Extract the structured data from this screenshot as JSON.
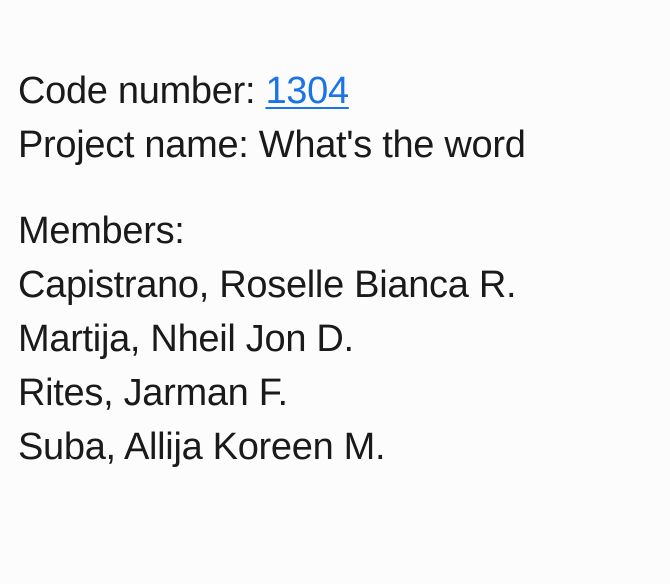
{
  "note": {
    "code_label": "Code number: ",
    "code_value": "1304",
    "project_label": "Project name: ",
    "project_value": "What's the word",
    "members_heading": "Members:",
    "members": [
      "Capistrano, Roselle Bianca R.",
      "Martija, Nheil Jon D.",
      "Rites, Jarman F.",
      "Suba, Allija Koreen M."
    ]
  },
  "colors": {
    "link": "#1a73e8",
    "text": "#1a1a1a",
    "background": "#fcfcfc"
  }
}
